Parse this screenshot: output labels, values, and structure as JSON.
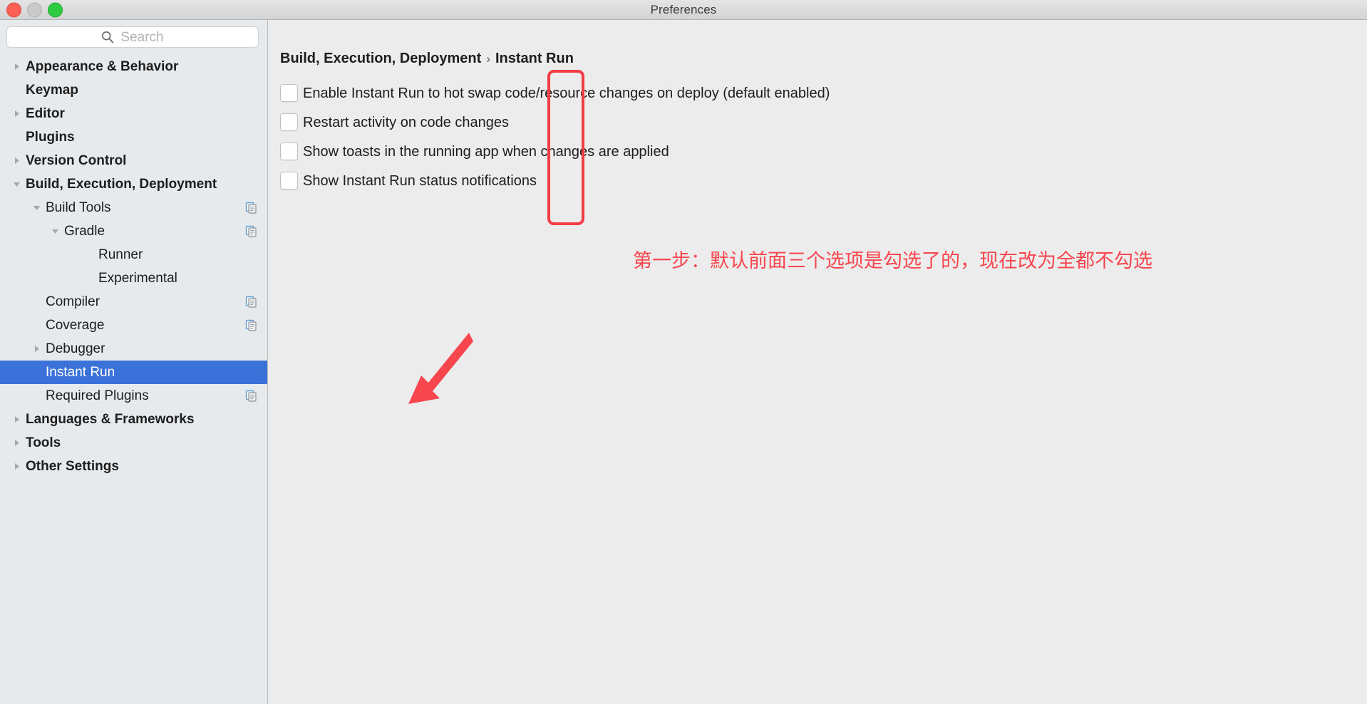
{
  "window": {
    "title": "Preferences",
    "traffic_lights": [
      "close-button",
      "minimize-button",
      "maximize-button"
    ]
  },
  "search": {
    "placeholder": "Search",
    "value": "",
    "icon": "search-icon"
  },
  "sidebar": {
    "items": [
      {
        "label": "Appearance & Behavior",
        "level": 0,
        "bold": true,
        "twisty": "collapsed",
        "scope_icon": false,
        "selected": false
      },
      {
        "label": "Keymap",
        "level": 0,
        "bold": true,
        "twisty": "none",
        "scope_icon": false,
        "selected": false
      },
      {
        "label": "Editor",
        "level": 0,
        "bold": true,
        "twisty": "collapsed",
        "scope_icon": false,
        "selected": false
      },
      {
        "label": "Plugins",
        "level": 0,
        "bold": true,
        "twisty": "none",
        "scope_icon": false,
        "selected": false
      },
      {
        "label": "Version Control",
        "level": 0,
        "bold": true,
        "twisty": "collapsed",
        "scope_icon": false,
        "selected": false
      },
      {
        "label": "Build, Execution, Deployment",
        "level": 0,
        "bold": true,
        "twisty": "expanded",
        "scope_icon": false,
        "selected": false
      },
      {
        "label": "Build Tools",
        "level": 1,
        "bold": false,
        "twisty": "expanded",
        "scope_icon": true,
        "selected": false
      },
      {
        "label": "Gradle",
        "level": 2,
        "bold": false,
        "twisty": "expanded",
        "scope_icon": true,
        "selected": false
      },
      {
        "label": "Runner",
        "level": 3,
        "bold": false,
        "twisty": "none",
        "scope_icon": false,
        "selected": false
      },
      {
        "label": "Experimental",
        "level": 3,
        "bold": false,
        "twisty": "none",
        "scope_icon": false,
        "selected": false
      },
      {
        "label": "Compiler",
        "level": 1,
        "bold": false,
        "twisty": "none",
        "scope_icon": true,
        "selected": false
      },
      {
        "label": "Coverage",
        "level": 1,
        "bold": false,
        "twisty": "none",
        "scope_icon": true,
        "selected": false
      },
      {
        "label": "Debugger",
        "level": 1,
        "bold": false,
        "twisty": "collapsed",
        "scope_icon": false,
        "selected": false
      },
      {
        "label": "Instant Run",
        "level": 1,
        "bold": false,
        "twisty": "none",
        "scope_icon": false,
        "selected": true
      },
      {
        "label": "Required Plugins",
        "level": 1,
        "bold": false,
        "twisty": "none",
        "scope_icon": true,
        "selected": false
      },
      {
        "label": "Languages & Frameworks",
        "level": 0,
        "bold": true,
        "twisty": "collapsed",
        "scope_icon": false,
        "selected": false
      },
      {
        "label": "Tools",
        "level": 0,
        "bold": true,
        "twisty": "collapsed",
        "scope_icon": false,
        "selected": false
      },
      {
        "label": "Other Settings",
        "level": 0,
        "bold": true,
        "twisty": "collapsed",
        "scope_icon": false,
        "selected": false
      }
    ]
  },
  "main": {
    "breadcrumb": {
      "root": "Build, Execution, Deployment",
      "separator": "›",
      "current": "Instant Run"
    },
    "options": [
      {
        "label": "Enable Instant Run to hot swap code/resource changes on deploy (default enabled)",
        "checked": false
      },
      {
        "label": "Restart activity on code changes",
        "checked": false
      },
      {
        "label": "Show toasts in the running app when changes are applied",
        "checked": false
      },
      {
        "label": "Show Instant Run status notifications",
        "checked": false
      }
    ]
  },
  "annotations": {
    "text": "第一步：默认前面三个选项是勾选了的，现在改为全都不勾选",
    "color": "#f8464f",
    "highlight_box": "checkbox-column",
    "arrow_target": "Instant Run"
  },
  "colors": {
    "selection_blue": "#3b72d9",
    "annotation_red": "#f8464f",
    "sidebar_bg": "#e6eaed",
    "main_bg": "#ececec",
    "traffic_close": "#ff6054",
    "traffic_min": "#c9c9c9",
    "traffic_zoom": "#2ecb42"
  }
}
